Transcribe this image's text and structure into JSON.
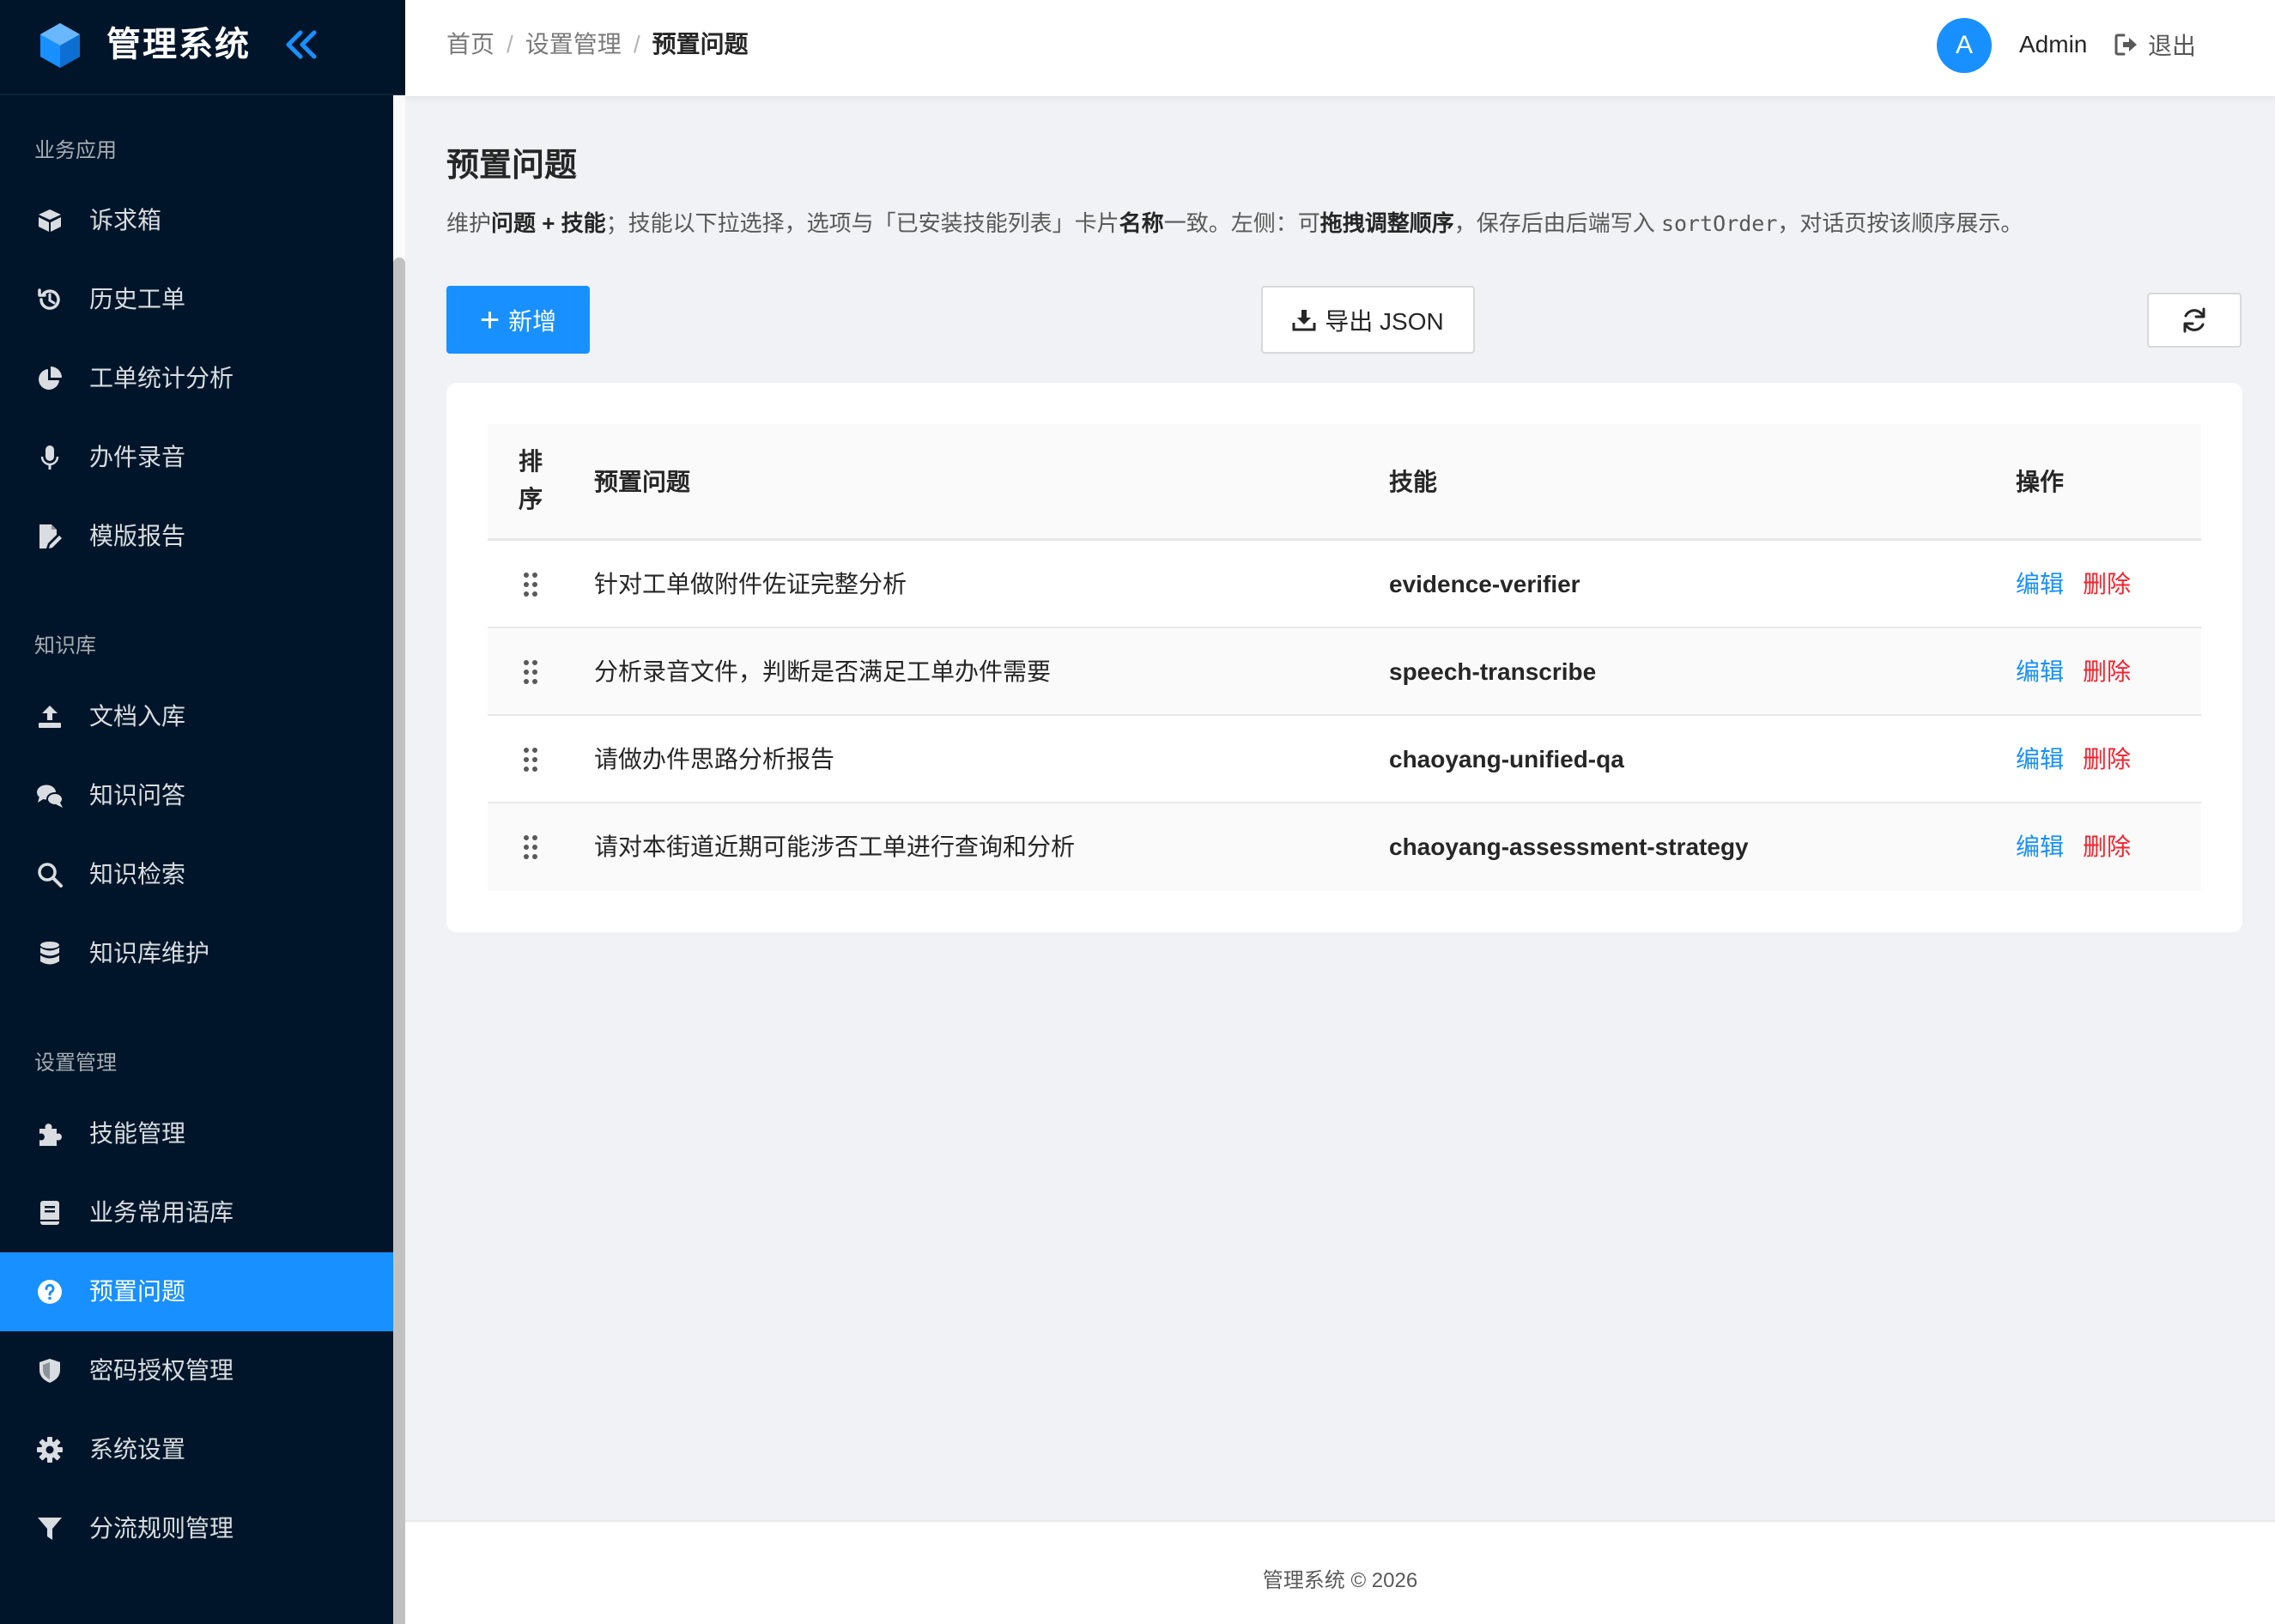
{
  "app": {
    "title": "管理系统",
    "brand_color": "#1890ff",
    "sidebar_bg": "#001529"
  },
  "sidebar": {
    "groups": [
      {
        "title": "业务应用",
        "items": [
          {
            "label": "诉求箱",
            "icon": "box-icon"
          },
          {
            "label": "历史工单",
            "icon": "history-icon"
          },
          {
            "label": "工单统计分析",
            "icon": "pie-chart-icon"
          },
          {
            "label": "办件录音",
            "icon": "microphone-icon"
          },
          {
            "label": "模版报告",
            "icon": "file-edit-icon"
          }
        ]
      },
      {
        "title": "知识库",
        "items": [
          {
            "label": "文档入库",
            "icon": "upload-icon"
          },
          {
            "label": "知识问答",
            "icon": "chat-icon"
          },
          {
            "label": "知识检索",
            "icon": "search-icon"
          },
          {
            "label": "知识库维护",
            "icon": "database-icon"
          }
        ]
      },
      {
        "title": "设置管理",
        "items": [
          {
            "label": "技能管理",
            "icon": "puzzle-icon"
          },
          {
            "label": "业务常用语库",
            "icon": "book-icon"
          },
          {
            "label": "预置问题",
            "icon": "question-circle-icon",
            "active": true
          },
          {
            "label": "密码授权管理",
            "icon": "shield-icon"
          },
          {
            "label": "系统设置",
            "icon": "gear-icon"
          },
          {
            "label": "分流规则管理",
            "icon": "filter-icon"
          }
        ]
      }
    ]
  },
  "header": {
    "breadcrumb": [
      "首页",
      "设置管理",
      "预置问题"
    ],
    "separator": "/",
    "avatar_letter": "A",
    "username": "Admin",
    "logout_label": "退出"
  },
  "main": {
    "title": "预置问题",
    "description": {
      "p1": "维护",
      "b1": "问题 + 技能",
      "p2": "；技能以下拉选择，选项与「已安装技能列表」卡片",
      "b2": "名称",
      "p3": "一致。左侧：可",
      "b3": "拖拽调整顺序",
      "p4": "，保存后由后端写入 ",
      "code": "sortOrder",
      "p5": "，对话页按该顺序展示。"
    },
    "add_button": "新增",
    "add_symbol": "+",
    "export_button": "导出 JSON",
    "table": {
      "columns": {
        "sort": "排序",
        "question": "预置问题",
        "skill": "技能",
        "actions": "操作"
      },
      "edit_label": "编辑",
      "delete_label": "删除",
      "rows": [
        {
          "question": "针对工单做附件佐证完整分析",
          "skill": "evidence-verifier"
        },
        {
          "question": "分析录音文件，判断是否满足工单办件需要",
          "skill": "speech-transcribe"
        },
        {
          "question": "请做办件思路分析报告",
          "skill": "chaoyang-unified-qa"
        },
        {
          "question": "请对本街道近期可能涉否工单进行查询和分析",
          "skill": "chaoyang-assessment-strategy"
        }
      ]
    }
  },
  "footer": {
    "text": "管理系统 © 2026"
  }
}
